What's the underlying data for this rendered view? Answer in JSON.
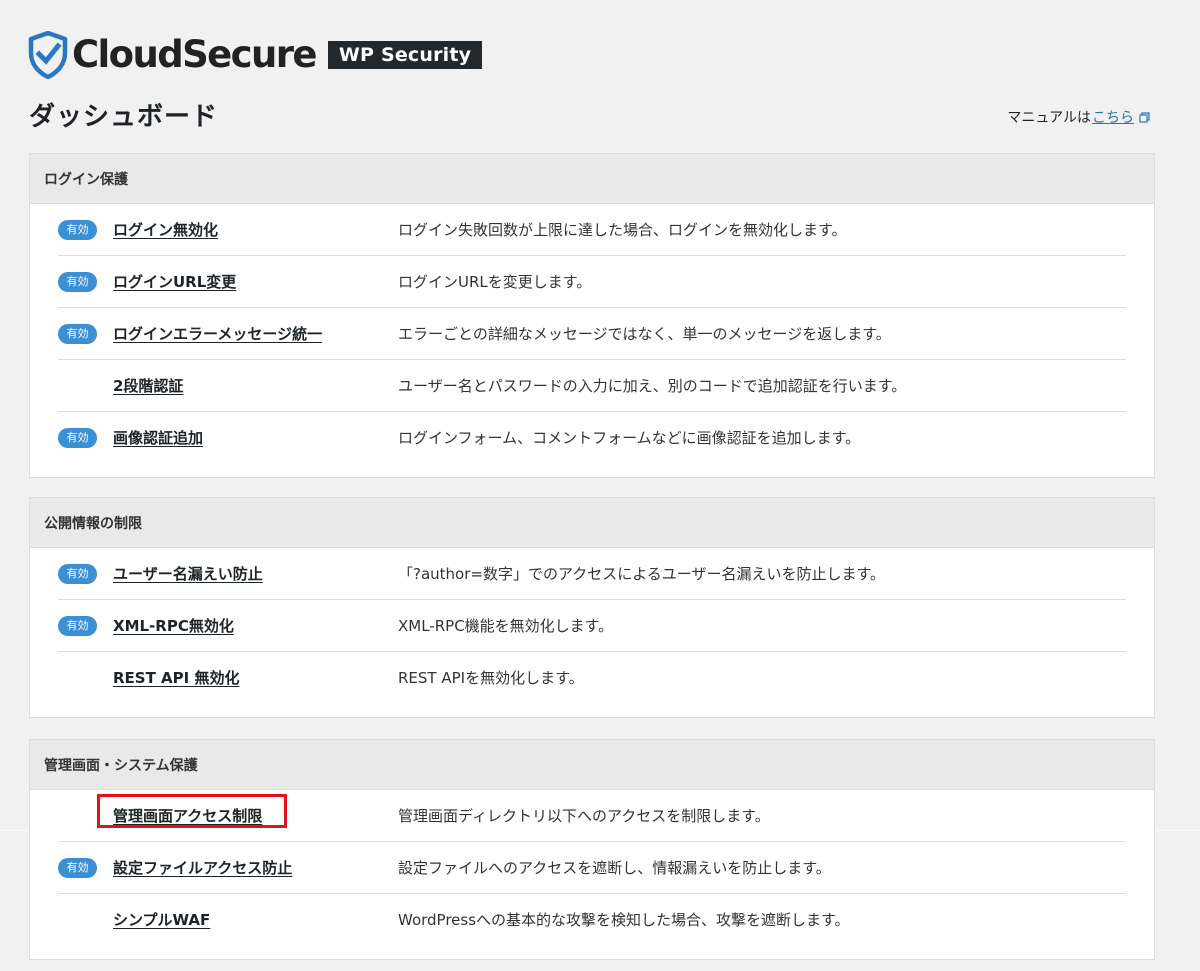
{
  "header": {
    "brand": "CloudSecure",
    "badge": "WP Security",
    "shield_icon": "shield-check-icon",
    "brand_color": "#2b78c2"
  },
  "page": {
    "title": "ダッシュボード",
    "manual_prefix": "マニュアルは",
    "manual_link": "こちら",
    "manual_icon": "external-link-icon"
  },
  "colors": {
    "badge_bg": "#3b8fd4",
    "highlight": "#e0141c",
    "link": "#2271b1"
  },
  "sections": [
    {
      "title": "ログイン保護",
      "rows": [
        {
          "badge": "有効",
          "name": "ログイン無効化",
          "desc": "ログイン失敗回数が上限に達した場合、ログインを無効化します。"
        },
        {
          "badge": "有効",
          "name": "ログインURL変更",
          "desc": "ログインURLを変更します。"
        },
        {
          "badge": "有効",
          "name": "ログインエラーメッセージ統一",
          "desc": "エラーごとの詳細なメッセージではなく、単一のメッセージを返します。"
        },
        {
          "badge": "",
          "name": "2段階認証",
          "desc": "ユーザー名とパスワードの入力に加え、別のコードで追加認証を行います。"
        },
        {
          "badge": "有効",
          "name": "画像認証追加",
          "desc": "ログインフォーム、コメントフォームなどに画像認証を追加します。"
        }
      ]
    },
    {
      "title": "公開情報の制限",
      "rows": [
        {
          "badge": "有効",
          "name": "ユーザー名漏えい防止",
          "desc": "「?author=数字」でのアクセスによるユーザー名漏えいを防止します。"
        },
        {
          "badge": "有効",
          "name": "XML-RPC無効化",
          "desc": "XML-RPC機能を無効化します。"
        },
        {
          "badge": "",
          "name": "REST API 無効化",
          "desc": "REST APIを無効化します。"
        }
      ]
    },
    {
      "title": "管理画面・システム保護",
      "rows": [
        {
          "badge": "",
          "name": "管理画面アクセス制限",
          "desc": "管理画面ディレクトリ以下へのアクセスを制限します。",
          "highlighted": true
        },
        {
          "badge": "有効",
          "name": "設定ファイルアクセス防止",
          "desc": "設定ファイルへのアクセスを遮断し、情報漏えいを防止します。"
        },
        {
          "badge": "",
          "name": "シンプルWAF",
          "desc": "WordPressへの基本的な攻撃を検知した場合、攻撃を遮断します。"
        }
      ]
    }
  ]
}
